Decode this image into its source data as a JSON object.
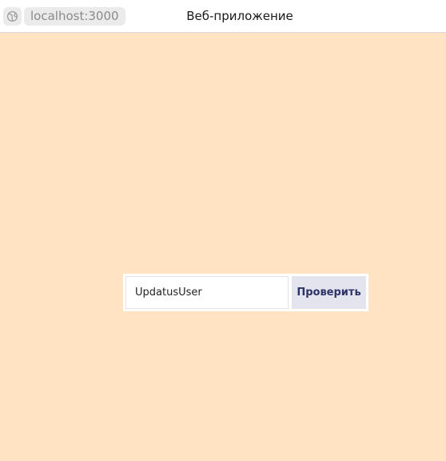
{
  "browser": {
    "url": "localhost:3000",
    "title": "Веб-приложение",
    "site_icon": "globe-icon"
  },
  "form": {
    "username_value": "UpdatusUser",
    "check_label": "Проверить"
  },
  "colors": {
    "page_background": "#ffe3c3",
    "button_background": "#e3e4ee",
    "button_text": "#2d3467"
  }
}
